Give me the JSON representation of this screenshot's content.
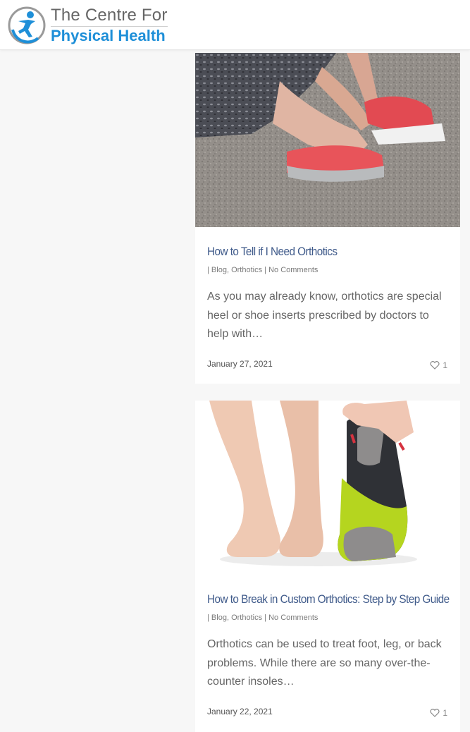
{
  "header": {
    "logo_line1": "The Centre For",
    "logo_line2": "Physical Health",
    "colors": {
      "brand_blue": "#1e8fd8",
      "logo_gray": "#666666"
    }
  },
  "posts": [
    {
      "title": "How to Tell if I Need Orthotics",
      "meta_prefix": "| ",
      "category1": "Blog",
      "category2": "Orthotics",
      "meta_sep": " | ",
      "comments": "No Comments",
      "excerpt": "As you may already know, orthotics are special heel or shoe inserts prescribed by doctors to help with…",
      "date": "January 27, 2021",
      "likes": "1"
    },
    {
      "title": "How to Break in Custom Orthotics: Step by Step Guide",
      "meta_prefix": "| ",
      "category1": "Blog",
      "category2": "Orthotics",
      "meta_sep": " | ",
      "comments": "No Comments",
      "excerpt": "Orthotics can be used to treat foot, leg, or back problems. While there are so many over-the-counter insoles…",
      "date": "January 22, 2021",
      "likes": "1"
    }
  ]
}
